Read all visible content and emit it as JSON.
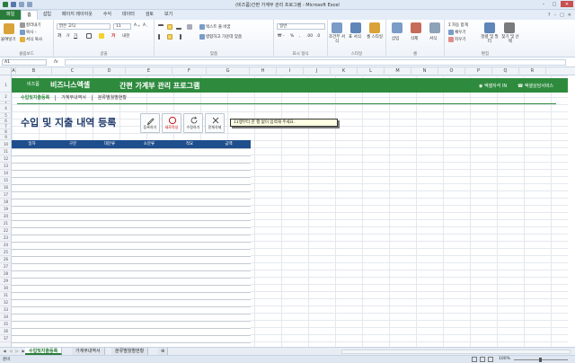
{
  "window": {
    "title": "(비즈폼)간편 가계부 관리 프로그램 - Microsoft Excel",
    "controls": [
      "–",
      "□",
      "✕"
    ]
  },
  "ribbon_tabs": [
    "파일",
    "홈",
    "삽입",
    "페이지 레이아웃",
    "수식",
    "데이터",
    "검토",
    "보기"
  ],
  "ribbon": {
    "clipboard": {
      "label": "클립보드",
      "paste": "붙여넣기",
      "cut": "잘라내기",
      "copy": "복사 -",
      "format_painter": "서식 복사"
    },
    "font": {
      "label": "글꼴",
      "name": "맑은 고딕",
      "size": "11"
    },
    "alignment": {
      "label": "맞춤",
      "wrap": "텍스트 줄 바꿈",
      "merge": "병합하고 가운데 맞춤"
    },
    "number": {
      "label": "표시 형식",
      "format": "일반"
    },
    "styles": {
      "label": "스타일",
      "conditional": "조건부 서식",
      "table": "표 서식",
      "cell": "셀 스타일"
    },
    "cells": {
      "label": "셀",
      "insert": "삽입",
      "delete": "삭제",
      "format": "서식"
    },
    "editing": {
      "label": "편집",
      "autosum": "자동 합계",
      "fill": "채우기",
      "clear": "지우기",
      "sort": "정렬 및 필터",
      "find": "찾기 및 선택"
    }
  },
  "formula_bar": {
    "name_box": "A1",
    "fx": "fx",
    "formula": ""
  },
  "columns": [
    "A",
    "B",
    "C",
    "D",
    "E",
    "F",
    "G",
    "H",
    "I",
    "J",
    "K",
    "L",
    "M",
    "N",
    "O",
    "P",
    "Q",
    "R"
  ],
  "rows": [
    "1",
    "2",
    "3",
    "4",
    "5",
    "6",
    "7",
    "8",
    "9",
    "10",
    "11",
    "12",
    "13",
    "14",
    "15",
    "16",
    "17",
    "18",
    "19",
    "20",
    "21",
    "22",
    "23",
    "24",
    "25",
    "26",
    "27",
    "28",
    "29",
    "30",
    "31",
    "32",
    "33",
    "34",
    "35",
    "36",
    "37"
  ],
  "banner": {
    "brand_small": "비즈폼",
    "brand": "비즈니스엑셀",
    "title": "간편 가계부 관리 프로그램",
    "link1": "엑셀자석 IN",
    "link2": "엑셀상담서비스"
  },
  "subnav": [
    "수입및지출등록",
    "가계부내역서",
    "분류별월별현황"
  ],
  "page_heading": "수입 및 지출 내역 등록",
  "tools": [
    {
      "label": "등록하기",
      "icon": "pencil-icon"
    },
    {
      "label": "새로작성",
      "icon": "circle-icon"
    },
    {
      "label": "수정하기",
      "icon": "refresh-icon"
    },
    {
      "label": "전체삭제",
      "icon": "x-icon"
    }
  ],
  "note": "11행부터 한 행 없이 입력해 주세요.",
  "table": {
    "headers": [
      "일자",
      "구분",
      "대분류",
      "소분류",
      "적요",
      "금액"
    ]
  },
  "sheet_tabs": [
    "수입및지출등록",
    "가계부내역서",
    "분류별월별현황"
  ],
  "status": {
    "ready": "준비",
    "zoom": "100%"
  },
  "colors": {
    "brand_green": "#2e8b3e",
    "header_blue": "#1f4e8c",
    "heading_navy": "#1f3a6b"
  }
}
